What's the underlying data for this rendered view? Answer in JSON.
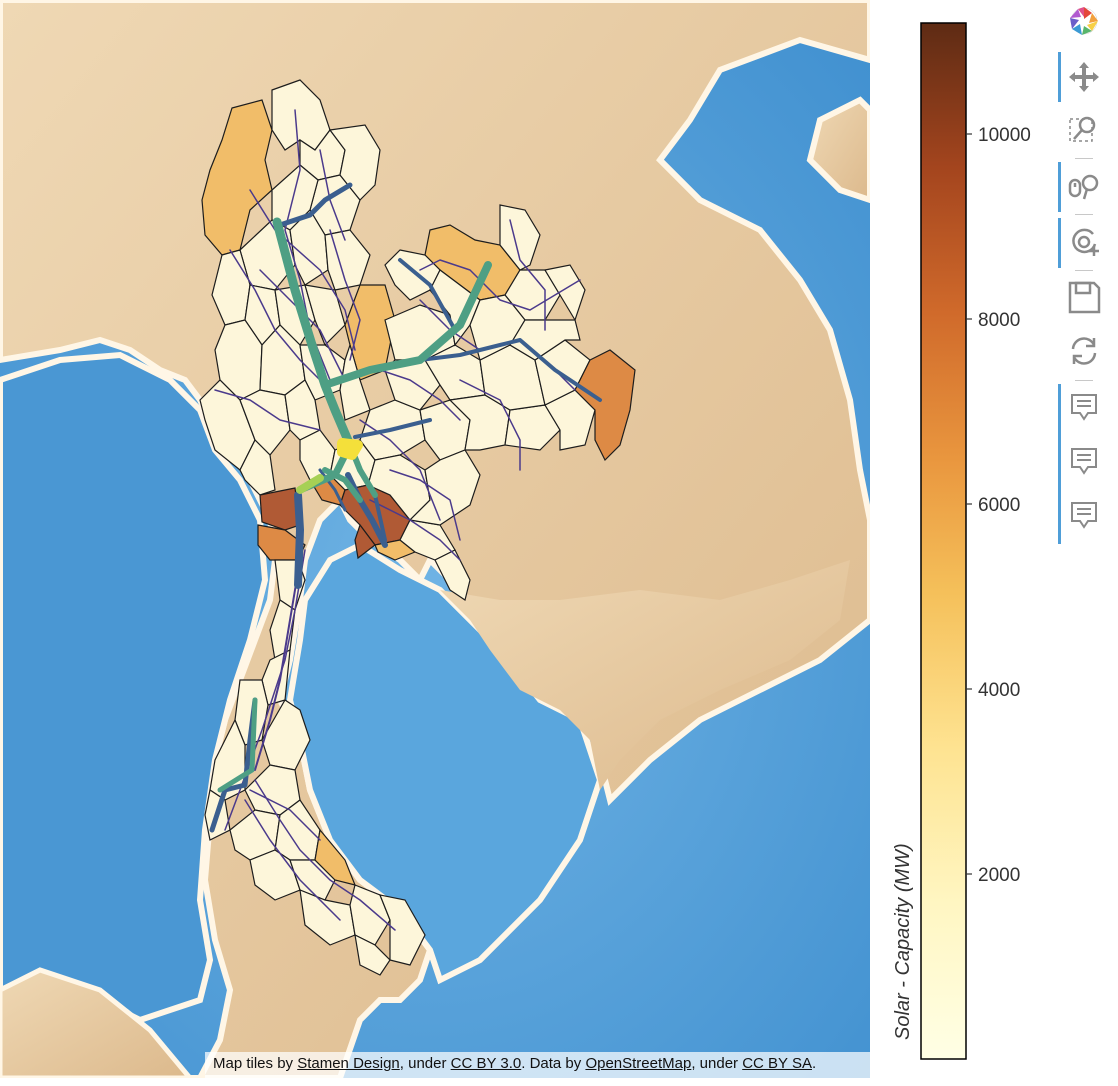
{
  "map": {
    "attribution": {
      "prefix": "Map tiles by ",
      "link1": "Stamen Design",
      "mid1": ", under ",
      "link2": "CC BY 3.0",
      "mid2": ". Data by ",
      "link3": "OpenStreetMap",
      "mid3": ", under ",
      "link4": "CC BY SA",
      "suffix": "."
    },
    "colors": {
      "ocean": "#4d9bd6",
      "land": "#e9cfa8",
      "region_low": "#fdf6da",
      "region_mid": "#f1bd69",
      "region_orange": "#dd8a45",
      "region_dark": "#b05a35",
      "line_major": "#4e9f84",
      "line_mid": "#3b5f8f",
      "line_minor": "#4b3a8c",
      "line_yellow": "#f4e03a",
      "line_lime": "#a6d055"
    }
  },
  "colorbar": {
    "title": "Solar - Capacity (MW)",
    "ticks": [
      "10000",
      "8000",
      "6000",
      "4000",
      "2000"
    ],
    "tick_values": [
      10000,
      8000,
      6000,
      4000,
      2000
    ],
    "min": 0,
    "max": 11200
  },
  "toolbar": {
    "tools": [
      "bokeh-logo-icon",
      "pan-icon",
      "box-zoom-icon",
      "wheel-zoom-icon",
      "zoom-in-icon",
      "save-icon",
      "reset-icon",
      "hover-icon",
      "hover-icon",
      "hover-icon"
    ]
  }
}
